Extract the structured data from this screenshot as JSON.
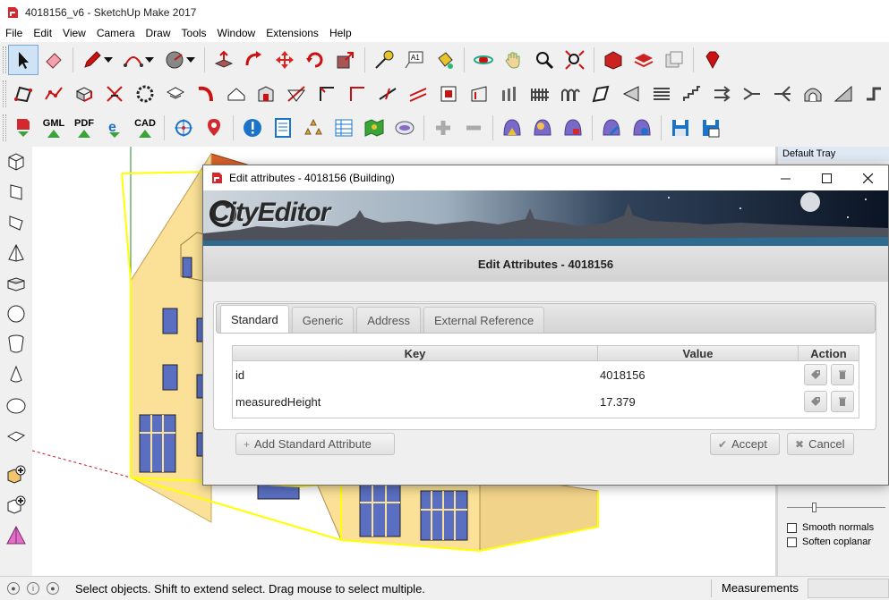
{
  "window": {
    "title": "4018156_v6 - SketchUp Make 2017"
  },
  "menu": [
    "File",
    "Edit",
    "View",
    "Camera",
    "Draw",
    "Tools",
    "Window",
    "Extensions",
    "Help"
  ],
  "toolbar3": {
    "labels": [
      "GML",
      "PDF",
      "CAD"
    ]
  },
  "tray": {
    "title": "Default Tray",
    "smooth_normals": "Smooth normals",
    "soften_coplanar": "Soften coplanar"
  },
  "status": {
    "message": "Select objects. Shift to extend select. Drag mouse to select multiple.",
    "measurements_label": "Measurements"
  },
  "dialog": {
    "title": "Edit attributes - 4018156 (Building)",
    "heading": "Edit Attributes - 4018156",
    "banner_text": "CityEditor",
    "tabs": [
      "Standard",
      "Generic",
      "Address",
      "External Reference"
    ],
    "active_tab": "Standard",
    "columns": {
      "key": "Key",
      "value": "Value",
      "action": "Action"
    },
    "rows": [
      {
        "key": "id",
        "value": "4018156"
      },
      {
        "key": "measuredHeight",
        "value": "17.379"
      }
    ],
    "add_button": "Add Standard Attribute",
    "accept_button": "Accept",
    "cancel_button": "Cancel"
  },
  "colors": {
    "roof": "#d9622b",
    "wall": "#fbe197",
    "window": "#5a6fc2",
    "selection": "#ffff00",
    "accent": "#c81e1e"
  }
}
